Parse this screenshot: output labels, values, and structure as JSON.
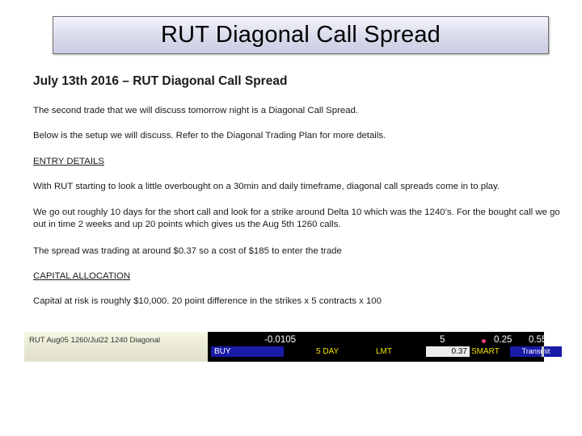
{
  "slide": {
    "title": "RUT Diagonal Call Spread"
  },
  "doc": {
    "heading": "July 13th 2016 – RUT Diagonal Call Spread",
    "p1": "The second trade that we will discuss tomorrow night is a Diagonal Call Spread.",
    "p2": "Below is the setup we will discuss. Refer to the Diagonal Trading Plan for more details.",
    "entry_header": "ENTRY DETAILS",
    "p3": "With RUT starting to look a little overbought on a 30min and daily timeframe, diagonal call spreads come in to play.",
    "p4_line1": "We go out roughly 10 days for the short call and look for a strike around Delta 10 which was the 1240’s. For the bought call we go",
    "p4_line2": "out in time 2 weeks and up 20 points which gives us the Aug 5th 1260 calls.",
    "p5": "The spread was trading at around $0.37 so a cost of $185 to enter the trade",
    "capital_header": "CAPITAL ALLOCATION",
    "p6": "Capital at risk is roughly $10,000. 20 point difference in the strikes x 5 contracts x 100"
  },
  "order": {
    "description": "RUT Aug05 1260/Jul22 1240 Diagonal",
    "change": "-0.0105",
    "quantity": "5",
    "bid": "0.25",
    "ask": "0.55",
    "action": "BUY",
    "tif_qty": "5",
    "tif": "DAY",
    "order_type": "LMT",
    "limit_price": "0.37",
    "route": "SMART",
    "transmit_label": "Transmit"
  },
  "colors": {
    "order_blue": "#1a1aa8",
    "order_yellow": "#f2e200",
    "marker_pink": "#ff3c8a"
  }
}
